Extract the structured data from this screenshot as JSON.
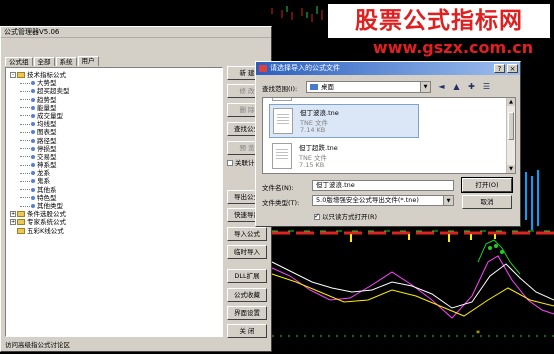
{
  "watermark": {
    "line1": "股票公式指标网",
    "line2": "www.gszx.com.cn"
  },
  "main_window": {
    "title": "公式管理器V5.06",
    "tabs": [
      {
        "label": "公式组",
        "active": false
      },
      {
        "label": "全部",
        "active": false
      },
      {
        "label": "系统",
        "active": false
      },
      {
        "label": "用户",
        "active": true
      }
    ],
    "tree": [
      {
        "level": 0,
        "type": "folder",
        "expander": "-",
        "label": "技术指标公式"
      },
      {
        "level": 1,
        "type": "leaf",
        "label": "大势型"
      },
      {
        "level": 1,
        "type": "leaf",
        "label": "超买超卖型"
      },
      {
        "level": 1,
        "type": "leaf",
        "label": "趋势型"
      },
      {
        "level": 1,
        "type": "leaf",
        "label": "能量型"
      },
      {
        "level": 1,
        "type": "leaf",
        "label": "成交量型"
      },
      {
        "level": 1,
        "type": "leaf",
        "label": "均线型"
      },
      {
        "level": 1,
        "type": "leaf",
        "label": "图表型"
      },
      {
        "level": 1,
        "type": "leaf",
        "label": "路径型"
      },
      {
        "level": 1,
        "type": "leaf",
        "label": "停损型"
      },
      {
        "level": 1,
        "type": "leaf",
        "label": "交易型"
      },
      {
        "level": 1,
        "type": "leaf",
        "label": "神系型"
      },
      {
        "level": 1,
        "type": "leaf",
        "label": "龙系"
      },
      {
        "level": 1,
        "type": "leaf",
        "label": "鬼系"
      },
      {
        "level": 1,
        "type": "leaf",
        "label": "其他系"
      },
      {
        "level": 1,
        "type": "leaf",
        "label": "特色型"
      },
      {
        "level": 1,
        "type": "leaf",
        "label": "其他类型"
      },
      {
        "level": 0,
        "type": "folder",
        "expander": "+",
        "label": "条件选股公式"
      },
      {
        "level": 0,
        "type": "folder",
        "expander": "+",
        "label": "专家系统公式"
      },
      {
        "level": 0,
        "type": "folder",
        "expander": "",
        "label": "五彩K线公式"
      }
    ],
    "buttons": [
      "新 建",
      "修 改",
      "删 除",
      "查找公式",
      "预 览",
      "",
      "导出公式",
      "快速导出",
      "导入公式",
      "临时导入",
      "DLL扩展",
      "公式收藏",
      "界面设置",
      "关 闭"
    ],
    "checkbox_label": "关联计算公式",
    "status": "访问高级指公式讨论区"
  },
  "file_dialog": {
    "title": "请选择导入的公式文件",
    "look_in_label": "查找范围(I):",
    "look_in_value": "桌面",
    "nav_icons": [
      "back-icon",
      "up-folder-icon",
      "new-folder-icon",
      "view-menu-icon"
    ],
    "files": [
      {
        "name": "...",
        "type": "",
        "size": "",
        "selected": false
      },
      {
        "name": "但丁波浪.tne",
        "type": "TNE 文件",
        "size": "7.14 KB",
        "selected": true
      },
      {
        "name": "但丁超跌.tne",
        "type": "TNE 文件",
        "size": "7.15 KB",
        "selected": false
      }
    ],
    "filename_label": "文件名(N):",
    "filename_value": "但丁波浪.tne",
    "filetype_label": "文件类型(T):",
    "filetype_value": "5.0版增强安全公式导出文件(*.tne)",
    "open_button": "打开(O)",
    "cancel_button": "取消",
    "readonly_label": "以只读方式打开(R)",
    "readonly_checked": true
  }
}
